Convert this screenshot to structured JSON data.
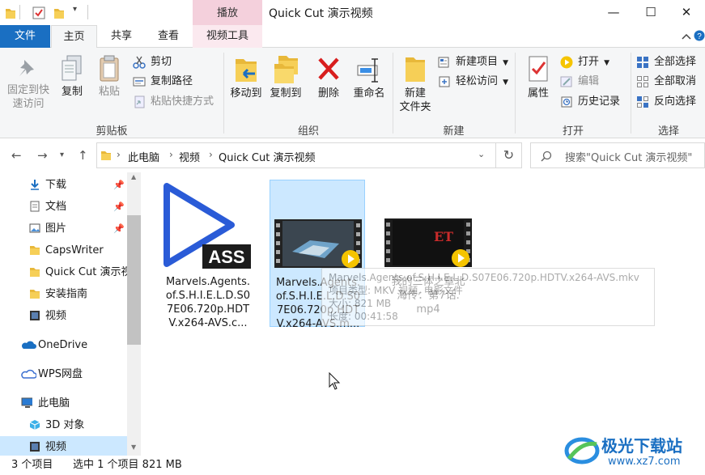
{
  "window": {
    "title": "Quick Cut 演示视频",
    "context_tab_header": "播放",
    "controls": {
      "minimize": "—",
      "maximize": "☐",
      "close": "✕"
    }
  },
  "tabs": {
    "file": "文件",
    "home": "主页",
    "share": "共享",
    "view": "查看",
    "video_tools": "视频工具",
    "collapse": "^",
    "help": "?"
  },
  "ribbon": {
    "clipboard": {
      "group_label": "剪贴板",
      "pin": "固定到快\n速访问",
      "pin_l1": "固定到快",
      "pin_l2": "速访问",
      "copy": "复制",
      "paste": "粘贴",
      "cut": "剪切",
      "copy_path": "复制路径",
      "paste_shortcut": "粘贴快捷方式"
    },
    "organize": {
      "group_label": "组织",
      "move_to": "移动到",
      "copy_to": "复制到",
      "delete": "删除",
      "rename": "重命名"
    },
    "new": {
      "group_label": "新建",
      "new_folder_l1": "新建",
      "new_folder_l2": "文件夹",
      "new_item": "新建项目",
      "easy_access": "轻松访问"
    },
    "open": {
      "group_label": "打开",
      "properties": "属性",
      "open": "打开",
      "edit": "编辑",
      "history": "历史记录"
    },
    "select": {
      "group_label": "选择",
      "select_all": "全部选择",
      "select_none": "全部取消",
      "invert": "反向选择"
    }
  },
  "address": {
    "crumbs": [
      "此电脑",
      "视频",
      "Quick Cut 演示视频"
    ],
    "search_placeholder": "搜索\"Quick Cut 演示视频\""
  },
  "nav": {
    "items": [
      {
        "label": "下载",
        "icon": "download-icon",
        "pinned": true
      },
      {
        "label": "文档",
        "icon": "document-icon",
        "pinned": true
      },
      {
        "label": "图片",
        "icon": "picture-icon",
        "pinned": true
      },
      {
        "label": "CapsWriter",
        "icon": "folder-icon",
        "pinned": false
      },
      {
        "label": "Quick Cut 演示视",
        "icon": "folder-icon",
        "pinned": false
      },
      {
        "label": "安装指南",
        "icon": "folder-icon",
        "pinned": false
      },
      {
        "label": "视频",
        "icon": "video-icon",
        "pinned": false
      },
      {
        "label": "OneDrive",
        "icon": "onedrive-icon",
        "pinned": false
      },
      {
        "label": "WPS网盘",
        "icon": "cloud-icon",
        "pinned": false
      },
      {
        "label": "此电脑",
        "icon": "computer-icon",
        "pinned": false
      },
      {
        "label": "3D 对象",
        "icon": "3d-objects-icon",
        "pinned": false
      },
      {
        "label": "视频",
        "icon": "video-icon",
        "pinned": false
      }
    ],
    "pin_glyph": "📌"
  },
  "files": [
    {
      "name": "Marvels.Agents.of.S.H.I.E.L.D.S07E06.720p.HDTV.x264-AVS.c...",
      "name_display": "Marvels.Agents.\nof.S.H.I.E.L.D.S0\n7E06.720p.HDT\nV.x264-AVS.c...",
      "type": "ass",
      "badge": "ASS",
      "selected": false
    },
    {
      "name": "Marvels.Agents.of.S.H.I.E.L.D.S07E06.720p.HDTV.x264-AVS.m...",
      "name_display": "Marvels.Agents.\nof.S.H.I.E.L.D.S0\n7E06.720p.HDT\nV.x264-AVS.m...",
      "type": "video",
      "selected": true
    },
    {
      "name": "我的三体之章北海传：第7话.mp4",
      "name_display": "我的三体之章北\n海传：第7话.\nmp4",
      "type": "video",
      "thumb_text": "ET",
      "selected": false
    }
  ],
  "tooltip": {
    "line1": "Marvels.Agents.of.S.H.I.E.L.D.S07E06.720p.HDTV.x264-AVS.mkv",
    "line2": "项目类型: MKV 视频, 电影文件",
    "line3": "大小: 821 MB",
    "line4": "长度: 00:41:58"
  },
  "status": {
    "count": "3 个项目",
    "selected": "选中 1 个项目  821 MB"
  },
  "watermark": {
    "brand": "极光下载站",
    "url": "www.xz7.com"
  },
  "colors": {
    "accent": "#1a6fc2",
    "context_tab": "#f4d0dc",
    "selection": "#cce8ff",
    "play_badge": "#f5c400"
  }
}
